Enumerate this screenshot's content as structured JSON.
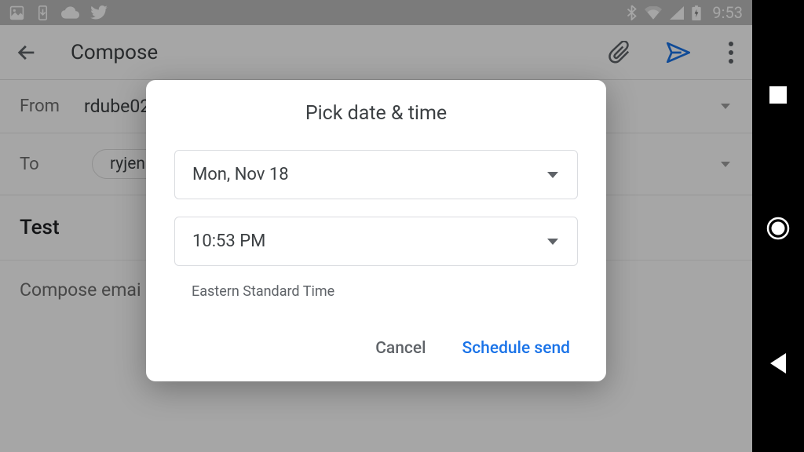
{
  "status": {
    "time": "9:53"
  },
  "toolbar": {
    "title": "Compose"
  },
  "compose": {
    "from_label": "From",
    "from_value": "rdube02(",
    "to_label": "To",
    "to_chip": "ryjen",
    "subject": "Test",
    "body_placeholder": "Compose emai"
  },
  "dialog": {
    "title": "Pick date & time",
    "date_value": "Mon, Nov 18",
    "time_value": "10:53 PM",
    "timezone": "Eastern Standard Time",
    "cancel_label": "Cancel",
    "schedule_label": "Schedule send"
  }
}
